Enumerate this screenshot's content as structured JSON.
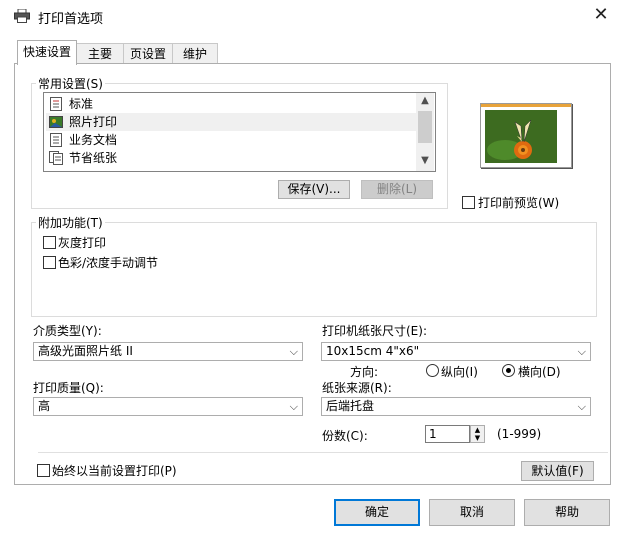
{
  "window": {
    "title": "打印首选项",
    "close_glyph": "✕"
  },
  "tabs": [
    {
      "label": "快速设置"
    },
    {
      "label": "主要"
    },
    {
      "label": "页设置"
    },
    {
      "label": "维护"
    }
  ],
  "common_settings": {
    "label": "常用设置(S)",
    "items": [
      {
        "label": "标准",
        "icon": "standard-doc-icon"
      },
      {
        "label": "照片打印",
        "icon": "photo-icon",
        "selected": true
      },
      {
        "label": "业务文档",
        "icon": "business-doc-icon"
      },
      {
        "label": "节省纸张",
        "icon": "save-paper-icon"
      }
    ],
    "save_button": "保存(V)...",
    "delete_button": "删除(L)"
  },
  "preview": {
    "checkbox_label": "打印前预览(W)",
    "checked": false
  },
  "additional_features": {
    "label": "附加功能(T)",
    "options": [
      {
        "label": "灰度打印",
        "checked": false
      },
      {
        "label": "色彩/浓度手动调节",
        "checked": false
      }
    ]
  },
  "media_type": {
    "label": "介质类型(Y):",
    "value": "高级光面照片纸 II"
  },
  "printer_paper_size": {
    "label": "打印机纸张尺寸(E):",
    "value": "10x15cm 4\"x6\""
  },
  "orientation": {
    "label": "方向:",
    "portrait": "纵向(I)",
    "landscape": "横向(D)",
    "selected": "landscape"
  },
  "print_quality": {
    "label": "打印质量(Q):",
    "value": "高"
  },
  "paper_source": {
    "label": "纸张来源(R):",
    "value": "后端托盘"
  },
  "copies": {
    "label": "份数(C):",
    "value": "1",
    "range": "(1-999)"
  },
  "always_print_current": {
    "label": "始终以当前设置打印(P)",
    "checked": false
  },
  "defaults_button": "默认值(F)",
  "footer": {
    "ok": "确定",
    "cancel": "取消",
    "help": "帮助"
  },
  "colors": {
    "accent": "#0078d7",
    "button_bg": "#e1e1e1",
    "border": "#adadad"
  }
}
